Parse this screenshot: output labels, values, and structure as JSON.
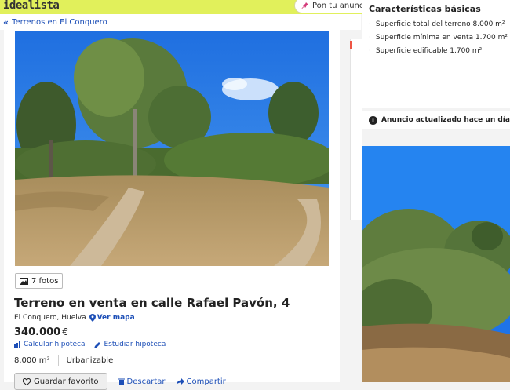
{
  "header": {
    "logo": "idealista",
    "publish_label": "Pon tu anuncio"
  },
  "breadcrumb": {
    "label": "Terrenos en El Conquero"
  },
  "listing": {
    "photo_count": "7 fotos",
    "title": "Terreno en venta en calle Rafael Pavón, 4",
    "location": "El Conquero, Huelva",
    "map_link": "Ver mapa",
    "price": "340.000",
    "currency": "€",
    "calc_link": "Calcular hipoteca",
    "study_link": "Estudiar hipoteca",
    "area": "8.000 m²",
    "type": "Urbanizable",
    "save_label": "Guardar favorito",
    "discard_label": "Descartar",
    "share_label": "Compartir"
  },
  "characteristics": {
    "title": "Características básicas",
    "items": [
      "Superficie total del terreno 8.000 m²",
      "Superficie mínima en venta 1.700 m²",
      "Superficie edificable 1.700 m²"
    ],
    "updated": "Anuncio actualizado hace un día"
  },
  "colors": {
    "brand": "#e1f05b",
    "link": "#1d4fb7"
  }
}
